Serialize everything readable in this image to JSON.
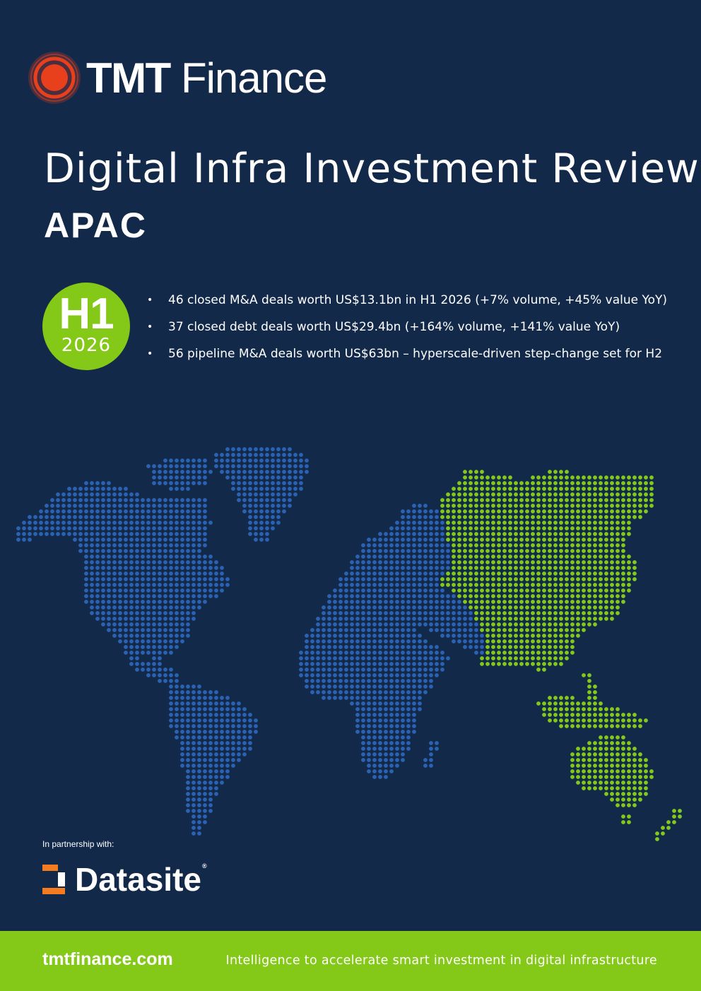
{
  "brand": {
    "name_bold": "TMT",
    "name_light": "Finance",
    "accent_color": "#e8401c"
  },
  "report": {
    "title": "Digital Infra Investment Review",
    "region": "APAC"
  },
  "badge": {
    "half": "H1",
    "year": "2026",
    "color": "#84c918"
  },
  "highlights": [
    "46 closed M&A deals worth US$13.1bn in H1 2026 (+7% volume, +45% value YoY)",
    "37 closed debt deals worth US$29.4bn (+164% volume, +141% value YoY)",
    "56 pipeline M&A deals worth US$63bn – hyperscale-driven step-change set for H2"
  ],
  "map": {
    "highlighted_region": "APAC",
    "base_color": "#2a63b3",
    "highlight_color": "#84c918"
  },
  "partner": {
    "label": "In partnership with:",
    "name": "Datasite",
    "mark": "®",
    "accent_color": "#f47b20"
  },
  "footer": {
    "website": "tmtfinance.com",
    "tagline": "Intelligence to accelerate smart investment in digital infrastructure"
  }
}
